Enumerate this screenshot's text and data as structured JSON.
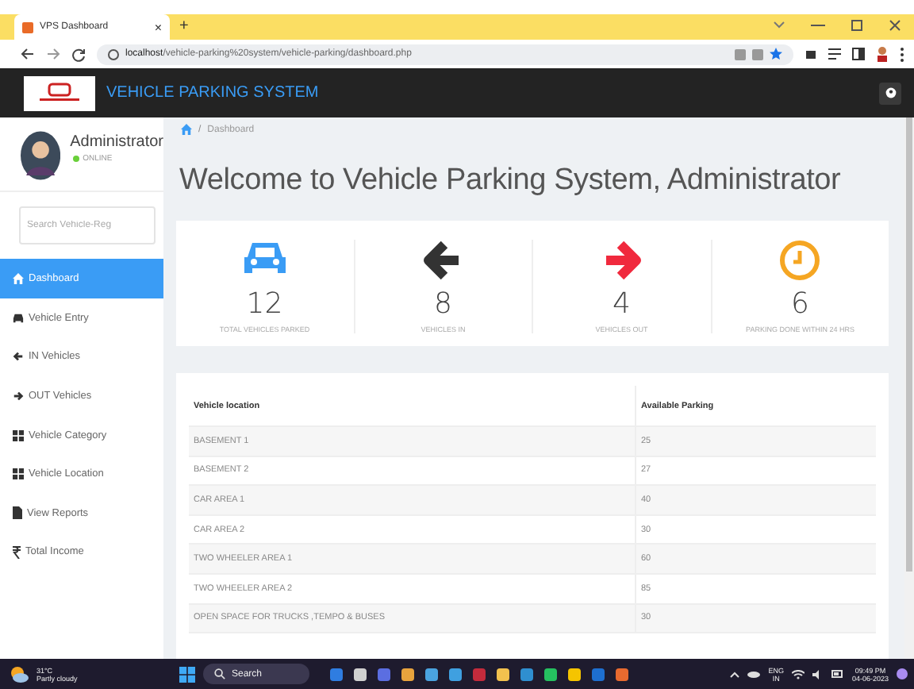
{
  "browser": {
    "tab_title": "VPS Dashboard",
    "tab_close": "×",
    "new_tab": "+",
    "url_host": "localhost",
    "url_path": "/vehicle-parking%20system/vehicle-parking/dashboard.php"
  },
  "app": {
    "title": "VEHICLE PARKING SYSTEM"
  },
  "user": {
    "name": "Administrator",
    "status": "ONLINE"
  },
  "search": {
    "placeholder": "Search Vehicle-Reg"
  },
  "menu": [
    {
      "label": "Dashboard",
      "kind": "home",
      "selected": true
    },
    {
      "label": "Vehicle Entry",
      "kind": "car",
      "selected": false
    },
    {
      "label": "IN Vehicles",
      "kind": "left",
      "selected": false
    },
    {
      "label": "OUT Vehicles",
      "kind": "right",
      "selected": false
    },
    {
      "label": "Vehicle Category",
      "kind": "grid",
      "selected": false
    },
    {
      "label": "Vehicle Location",
      "kind": "grid",
      "selected": false
    },
    {
      "label": "View Reports",
      "kind": "file",
      "selected": false
    },
    {
      "label": "Total Income",
      "kind": "rupee",
      "selected": false
    }
  ],
  "breadcrumb": {
    "separator": "/",
    "current": "Dashboard"
  },
  "heading": "Welcome to Vehicle Parking System, Administrator",
  "stats": [
    {
      "kind": "car",
      "value": "12",
      "label": "TOTAL VEHICLES PARKED"
    },
    {
      "kind": "in",
      "value": "8",
      "label": "VEHICLES IN"
    },
    {
      "kind": "out",
      "value": "4",
      "label": "VEHICLES OUT"
    },
    {
      "kind": "clock",
      "value": "6",
      "label": "PARKING DONE WITHIN 24 HRS"
    }
  ],
  "table": {
    "columns": [
      "Vehicle location",
      "Available Parking"
    ],
    "rows": [
      [
        "BASEMENT 1",
        "25"
      ],
      [
        "BASEMENT 2",
        "27"
      ],
      [
        "CAR AREA 1",
        "40"
      ],
      [
        "CAR AREA 2",
        "30"
      ],
      [
        "TWO WHEELER AREA 1",
        "60"
      ],
      [
        "TWO WHEELER AREA 2",
        "85"
      ],
      [
        "OPEN SPACE FOR TRUCKS ,TEMPO & BUSES",
        "30"
      ]
    ]
  },
  "taskbar": {
    "temperature": "31°C",
    "weather": "Partly cloudy",
    "search": "Search",
    "lang": "ENG",
    "region": "IN",
    "time": "09:49 PM",
    "date": "04-06-2023"
  }
}
